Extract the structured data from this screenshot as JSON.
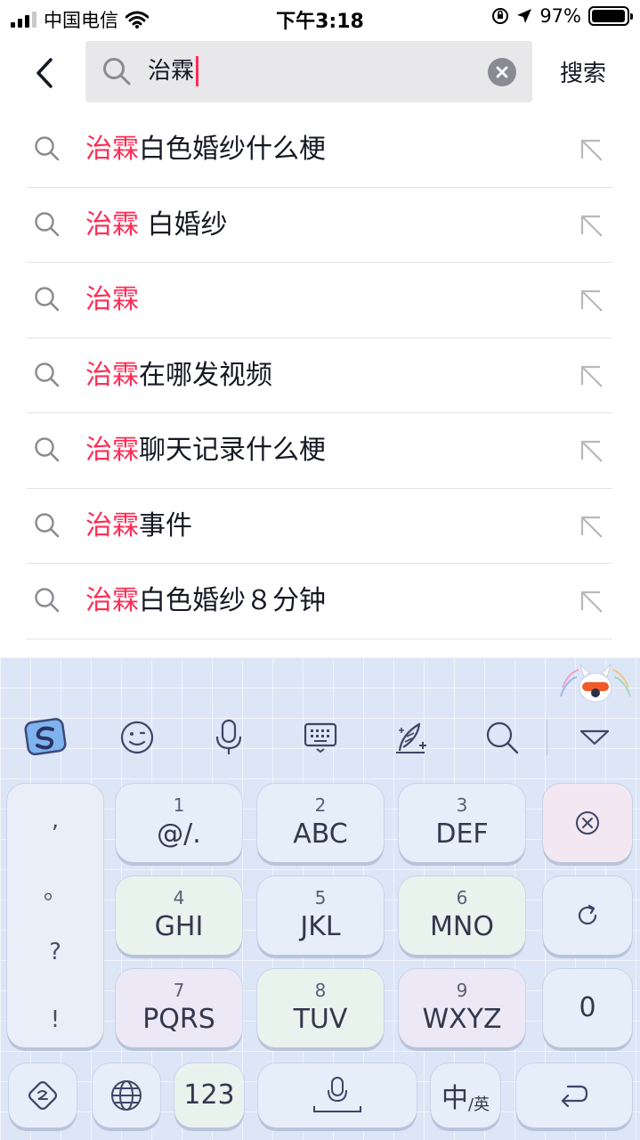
{
  "status_bar": {
    "carrier": "中国电信",
    "time": "下午3:18",
    "battery_percent": "97%",
    "battery_level": 0.97,
    "icons": [
      "signal-icon",
      "wifi-icon",
      "orientation-lock-icon",
      "location-arrow-icon",
      "battery-icon"
    ]
  },
  "search": {
    "query": "治霖",
    "search_button_label": "搜索",
    "icons": [
      "back-arrow-icon",
      "magnifier-icon",
      "clear-icon"
    ]
  },
  "suggestions": [
    {
      "highlight": "治霖",
      "rest": "白色婚纱什么梗"
    },
    {
      "highlight": "治霖",
      "rest": " 白婚纱"
    },
    {
      "highlight": "治霖",
      "rest": ""
    },
    {
      "highlight": "治霖",
      "rest": "在哪发视频"
    },
    {
      "highlight": "治霖",
      "rest": "聊天记录什么梗"
    },
    {
      "highlight": "治霖",
      "rest": "事件"
    },
    {
      "highlight": "治霖",
      "rest": "白色婚纱８分钟"
    }
  ],
  "keyboard": {
    "toolbar_icons": [
      "sogou-logo-icon",
      "emoji-icon",
      "microphone-icon",
      "keyboard-icon",
      "handwriting-icon",
      "search-icon",
      "collapse-icon"
    ],
    "punctuation": [
      ",",
      "。",
      "?",
      "!"
    ],
    "keys": [
      {
        "num": "1",
        "letters": "@/."
      },
      {
        "num": "2",
        "letters": "ABC"
      },
      {
        "num": "3",
        "letters": "DEF"
      },
      {
        "num": "4",
        "letters": "GHI"
      },
      {
        "num": "5",
        "letters": "JKL"
      },
      {
        "num": "6",
        "letters": "MNO"
      },
      {
        "num": "7",
        "letters": "PQRS"
      },
      {
        "num": "8",
        "letters": "TUV"
      },
      {
        "num": "9",
        "letters": "WXYZ"
      }
    ],
    "zero_key": "0",
    "bottom_row": {
      "numbers_label": "123",
      "lang_main": "中",
      "lang_sub": "/英"
    },
    "function_icons": [
      "delete-icon",
      "reset-icon",
      "emoji-switch-icon",
      "globe-icon",
      "space-mic-icon",
      "return-icon"
    ]
  }
}
